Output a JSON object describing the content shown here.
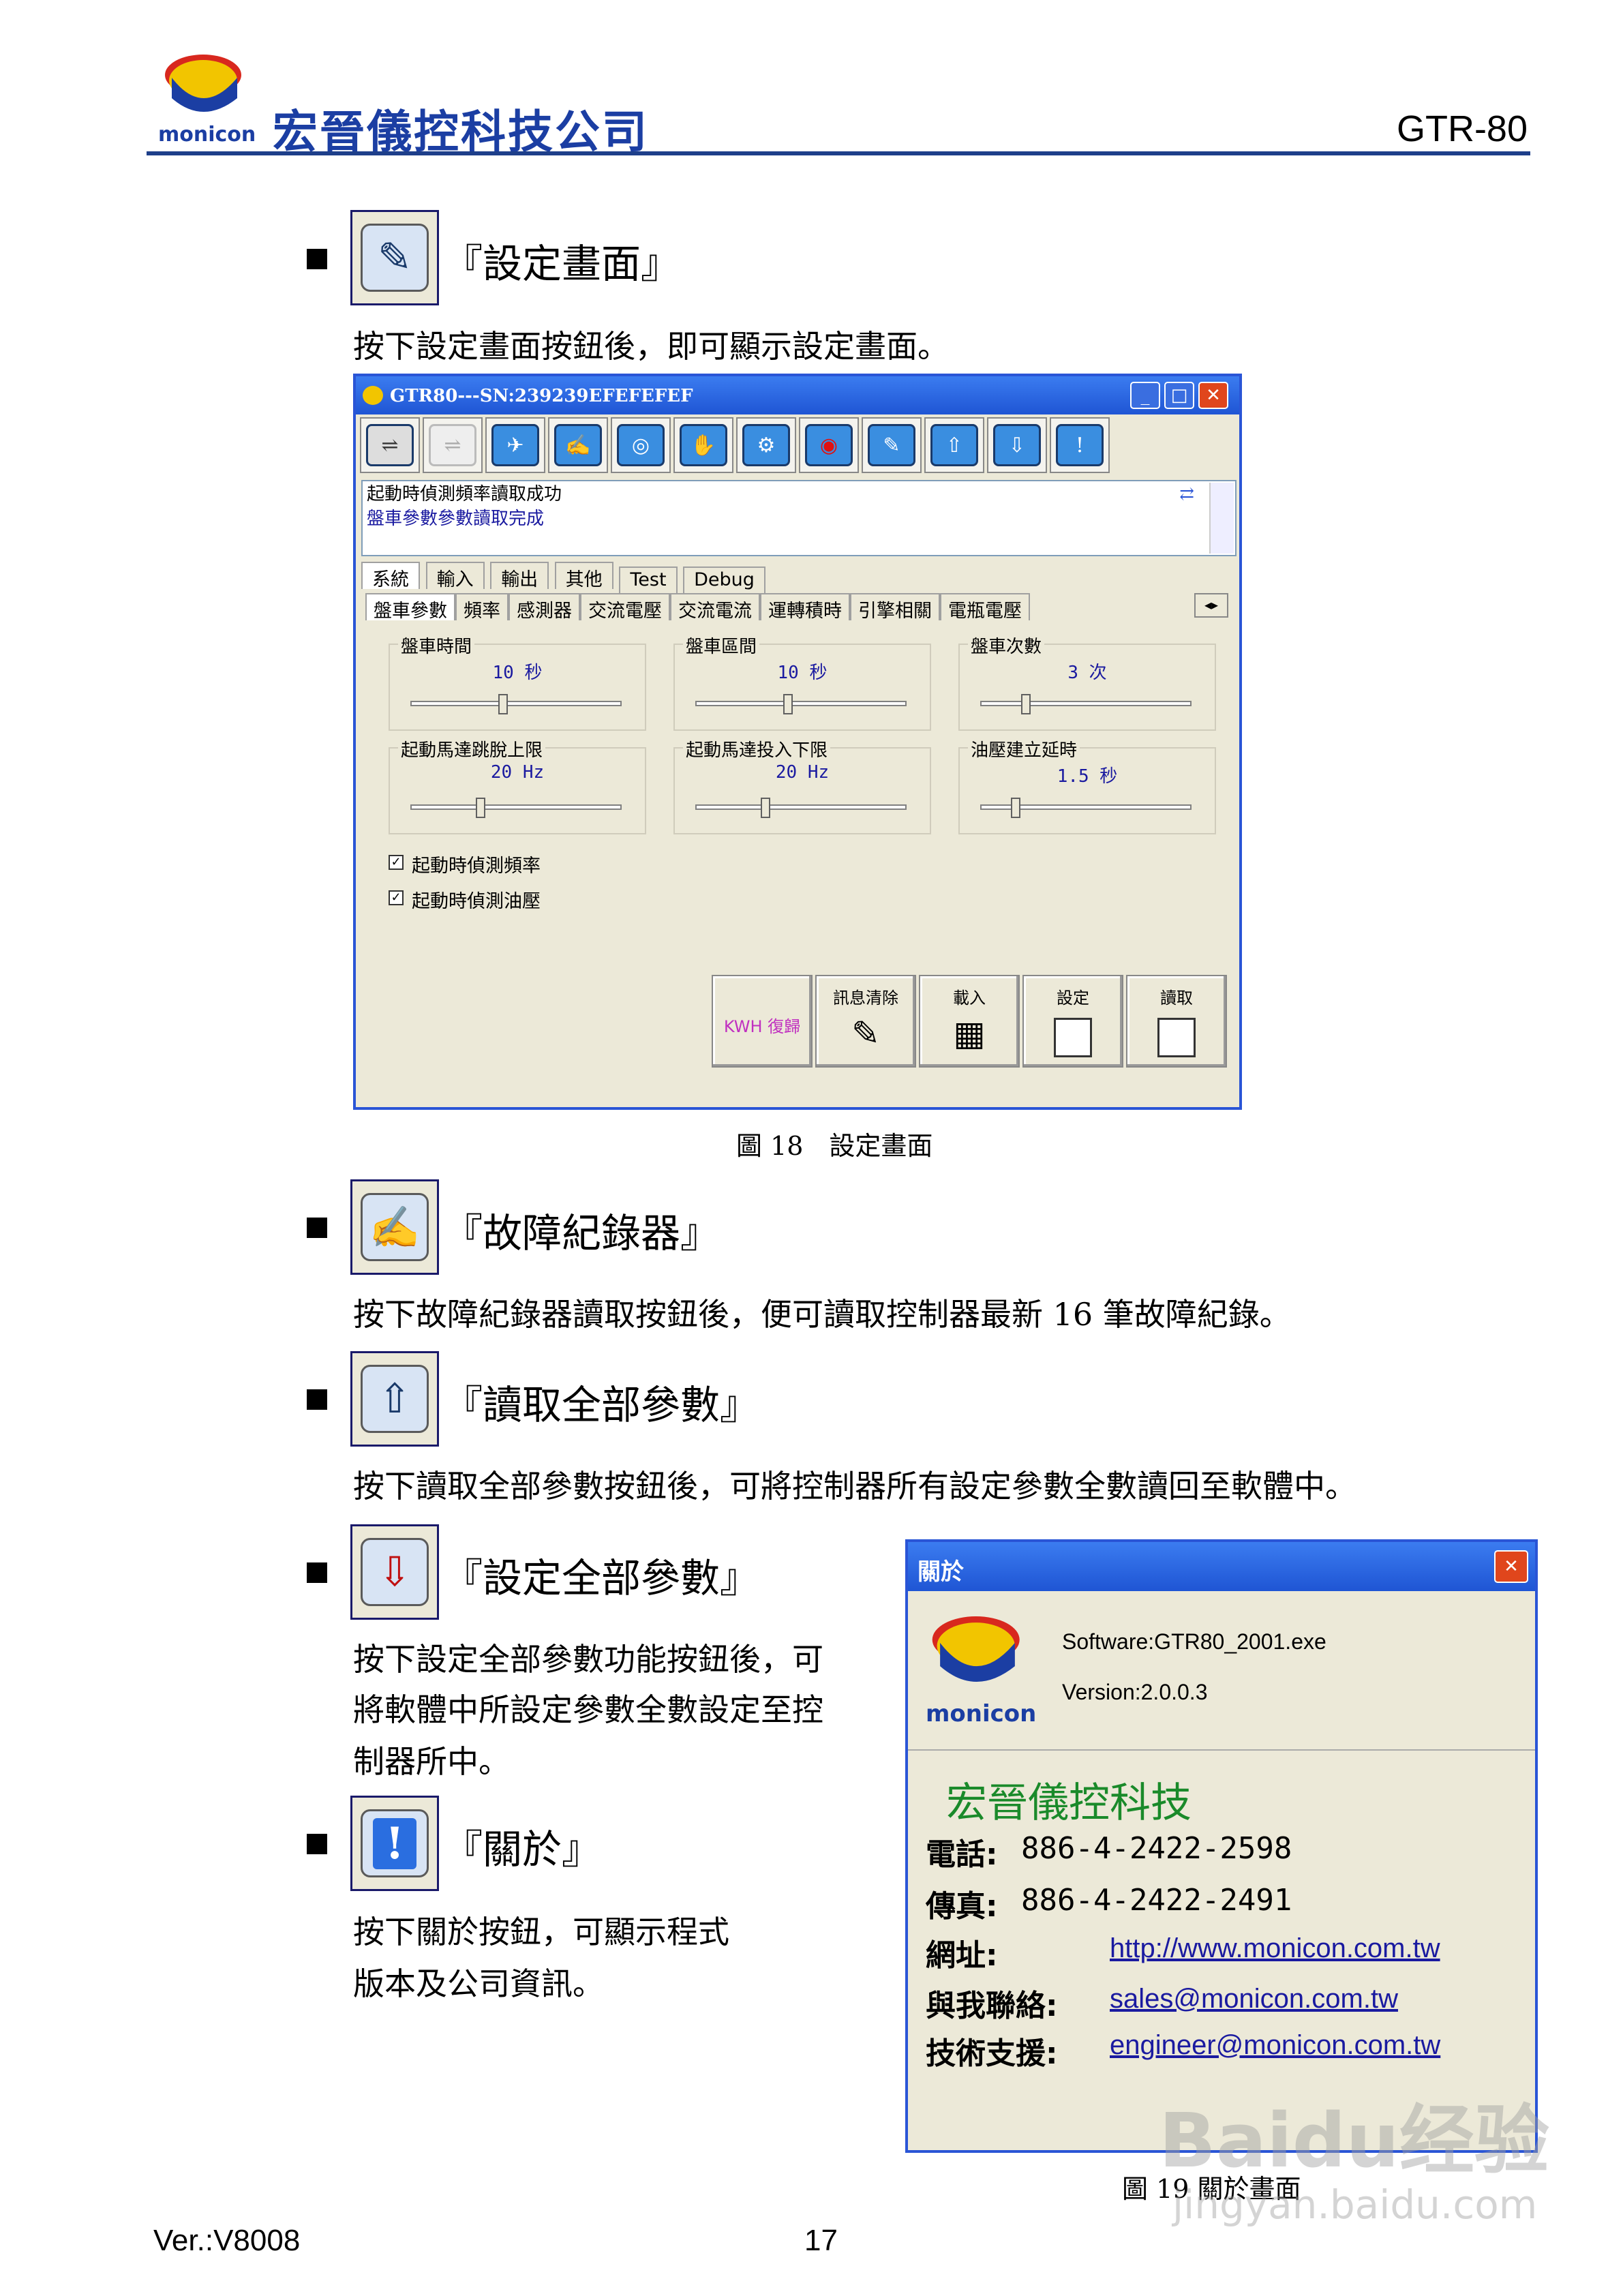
{
  "header": {
    "logo_text": "monicon",
    "company": "宏晉儀控科技公司",
    "model": "GTR-80"
  },
  "sections": {
    "settings": {
      "title": "『設定畫面』",
      "desc": "按下設定畫面按鈕後，即可顯示設定畫面。",
      "icon": "edit-icon"
    },
    "fault": {
      "title": "『故障紀錄器』",
      "desc": "按下故障紀錄器讀取按鈕後，便可讀取控制器最新 16 筆故障紀錄。",
      "icon": "pen-icon"
    },
    "read_all": {
      "title": "『讀取全部參數』",
      "desc": "按下讀取全部參數按鈕後，可將控制器所有設定參數全數讀回至軟體中。",
      "icon": "upload-icon"
    },
    "set_all": {
      "title": "『設定全部參數』",
      "desc_lines": [
        "按下設定全部參數功能按鈕後，可",
        "將軟體中所設定參數全數設定至控",
        "制器所中。"
      ],
      "icon": "download-icon"
    },
    "about": {
      "title": "『關於』",
      "desc_lines": [
        "按下關於按鈕，可顯示程式",
        "版本及公司資訊。"
      ],
      "icon": "exclamation-icon"
    }
  },
  "app_window": {
    "title": "GTR80---SN:239239EFEFEFEF",
    "messages": [
      "起動時偵測頻率讀取成功",
      "盤車參數參數讀取完成"
    ],
    "tabs_row1": [
      "系統",
      "輸入",
      "輸出",
      "其他",
      "Test",
      "Debug"
    ],
    "tabs_row2": [
      "盤車參數",
      "頻率",
      "感測器",
      "交流電壓",
      "交流電流",
      "運轉積時",
      "引擎相關",
      "電瓶電壓"
    ],
    "groups": [
      {
        "label": "盤車時間",
        "value": "10 秒",
        "level": 0.43
      },
      {
        "label": "盤車區間",
        "value": "10 秒",
        "level": 0.43
      },
      {
        "label": "盤車次數",
        "value": "3 次",
        "level": 0.2
      },
      {
        "label": "起動馬達跳脫上限",
        "value": "20 Hz",
        "level": 0.32
      },
      {
        "label": "起動馬達投入下限",
        "value": "20 Hz",
        "level": 0.32
      },
      {
        "label": "油壓建立延時",
        "value": "1.5 秒",
        "level": 0.15
      }
    ],
    "checkboxes": [
      {
        "label": "起動時偵測頻率",
        "checked": true
      },
      {
        "label": "起動時偵測油壓",
        "checked": true
      }
    ],
    "buttons": {
      "kwh": "KWH 復歸",
      "clear": "訊息清除",
      "load": "載入",
      "set": "設定",
      "read": "讀取"
    }
  },
  "captions": {
    "fig18": "圖 18　設定畫面",
    "fig19": "圖 19  關於畫面"
  },
  "about_dialog": {
    "title": "關於",
    "software": "Software:GTR80_2001.exe",
    "version": "Version:2.0.0.3",
    "logo_text": "monicon",
    "company": "宏晉儀控科技",
    "phone_label": "電話:",
    "phone": "886-4-2422-2598",
    "fax_label": "傳真:",
    "fax": "886-4-2422-2491",
    "web_label": "網址:",
    "web": "http://www.monicon.com.tw",
    "contact_label": "與我聯絡:",
    "contact": "sales@monicon.com.tw",
    "support_label": "技術支援:",
    "support": "engineer@monicon.com.tw"
  },
  "footer": {
    "version": "Ver.:V8008",
    "page": "17"
  },
  "watermark": {
    "brand": "Baidu经验",
    "url": "jingyan.baidu.com"
  },
  "colors": {
    "brand_blue": "#1b3ea3",
    "title_bar": "#1f55d4",
    "company_green": "#1a8a2a",
    "kwh_text": "#c030c0"
  }
}
